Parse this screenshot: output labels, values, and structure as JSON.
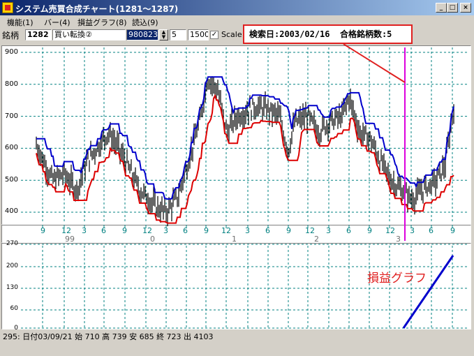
{
  "window": {
    "title": "システム売買合成チャート(1281〜1287)",
    "buttons": {
      "minimize": "_",
      "maximize": "□",
      "close": "×"
    }
  },
  "menu": [
    "機能(1)",
    "バー(4)",
    "損益グラフ(8)",
    "読込(9)"
  ],
  "toolbar": {
    "label": "銘柄",
    "code": "1282",
    "strategy": "買い転換②",
    "date": "980823",
    "period": "5",
    "amount": "1500",
    "scale_checked": "✓",
    "scale_label": "Scale"
  },
  "info": {
    "search_date": "検索日:2003/02/16",
    "passed_count": "合格銘柄数:5"
  },
  "price_axis": [
    "900",
    "800",
    "700",
    "600",
    "500",
    "400"
  ],
  "month_ticks": [
    "9",
    "12",
    "3",
    "6",
    "9",
    "12",
    "3",
    "6",
    "9",
    "12",
    "3",
    "6",
    "9",
    "12",
    "3",
    "6",
    "9",
    "12",
    "3",
    "6",
    "9"
  ],
  "year_labels": [
    "99",
    "0",
    "1",
    "2",
    "3"
  ],
  "pl_axis": [
    "270",
    "200",
    "130",
    "60",
    "0"
  ],
  "pl_label": "損益グラフ",
  "status_bar": "295:  日付03/09/21  始 710  高 739  安 685  終 723  出 4103",
  "colors": {
    "upper_band": "#0000cc",
    "lower_band": "#dd0000",
    "cursor": "#dd00dd",
    "highlight": "#e02020",
    "grid": "#008080",
    "pl_line": "#0000cc"
  }
}
